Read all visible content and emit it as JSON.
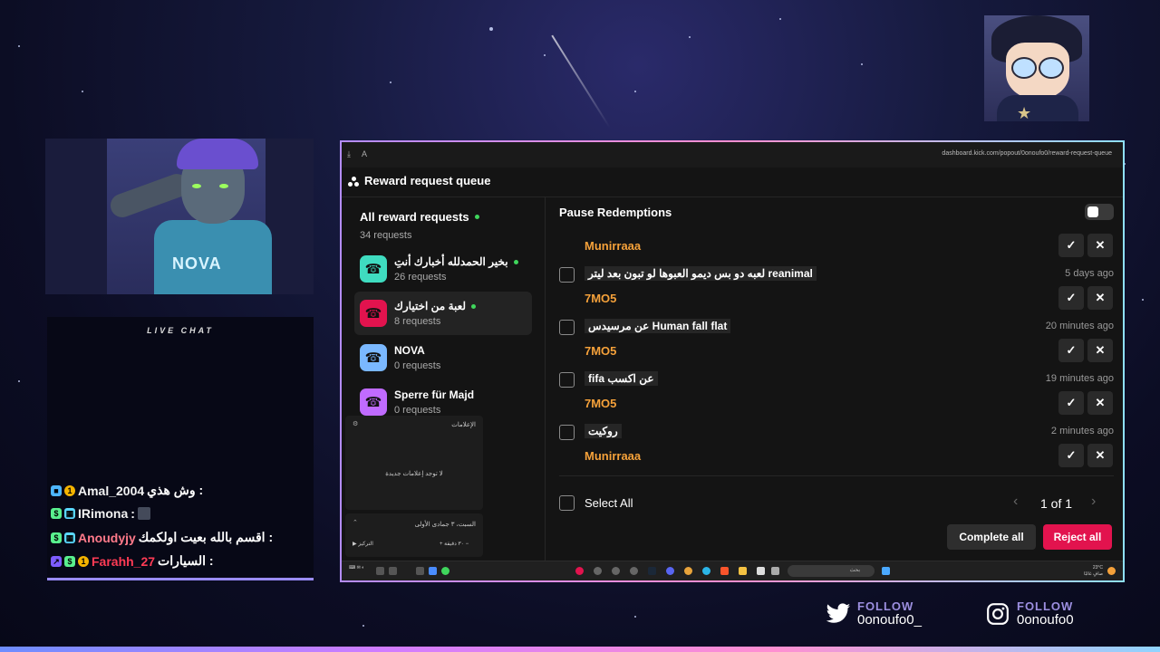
{
  "browser": {
    "url": "dashboard.kick.com/popout/0onoufo0/reward-request-queue"
  },
  "header": {
    "title": "Reward request queue"
  },
  "sidebar": {
    "all": {
      "label": "All reward requests",
      "count": "34 requests"
    },
    "items": [
      {
        "name": "بخير الحمدلله أخبارك أنتِ",
        "count": "26 requests",
        "online": true,
        "color": "#3fdcc0",
        "active": false
      },
      {
        "name": "لعبة من اختيارك",
        "count": "8 requests",
        "online": true,
        "color": "#e2134e",
        "active": true
      },
      {
        "name": "NOVA",
        "count": "0 requests",
        "online": false,
        "color": "#7ab8ff",
        "active": false
      },
      {
        "name": "Sperre für Majd",
        "count": "0 requests",
        "online": false,
        "color": "#c06bff",
        "active": false
      }
    ],
    "notifications": {
      "title": "الإعلامات",
      "empty": "لا توجد إعلامات جديدة"
    },
    "calendar": {
      "date": "السبت، ٣ جمادى الأولى",
      "minutes": "٣٠ دقيقة",
      "focus": "التركيز"
    }
  },
  "main": {
    "pause_label": "Pause Redemptions",
    "first_user": "Munirraaa",
    "requests": [
      {
        "text": "لعبه دو بس ديمو العبوها لو تبون بعد ليتر reanimal",
        "time": "5 days ago",
        "user": "7MO5"
      },
      {
        "text": "عن مرسيدس Human fall flat",
        "time": "20 minutes ago",
        "user": "7MO5"
      },
      {
        "text": "fifa عن اكسب",
        "time": "19 minutes ago",
        "user": "7MO5"
      },
      {
        "text": "روكيت",
        "time": "2 minutes ago",
        "user": "Munirraaa"
      }
    ],
    "select_all": "Select All",
    "pager": "1 of 1",
    "complete_all": "Complete all",
    "reject_all": "Reject all"
  },
  "taskbar": {
    "search_placeholder": "بحث",
    "weather": "23°C",
    "weather_desc": "صافٍ غالبًا"
  },
  "chat": {
    "title": "LIVE CHAT",
    "messages": [
      {
        "user": "Amal_2004",
        "color": "#f2f2f2",
        "text": "وش هذي :"
      },
      {
        "user": "IRimona",
        "color": "#f2f2f2",
        "text": ":"
      },
      {
        "user": "Anoudyjy",
        "color": "#ff7a8a",
        "text": "اقسم بالله بعيت اولكمك :"
      },
      {
        "user": "Farahh_27",
        "color": "#ff3b55",
        "text": "السيارات :"
      }
    ]
  },
  "social": [
    {
      "platform": "twitter",
      "follow": "FOLLOW",
      "handle": "0onoufo0_"
    },
    {
      "platform": "instagram",
      "follow": "FOLLOW",
      "handle": "0onoufo0"
    }
  ],
  "avatar_text": "NOVA"
}
